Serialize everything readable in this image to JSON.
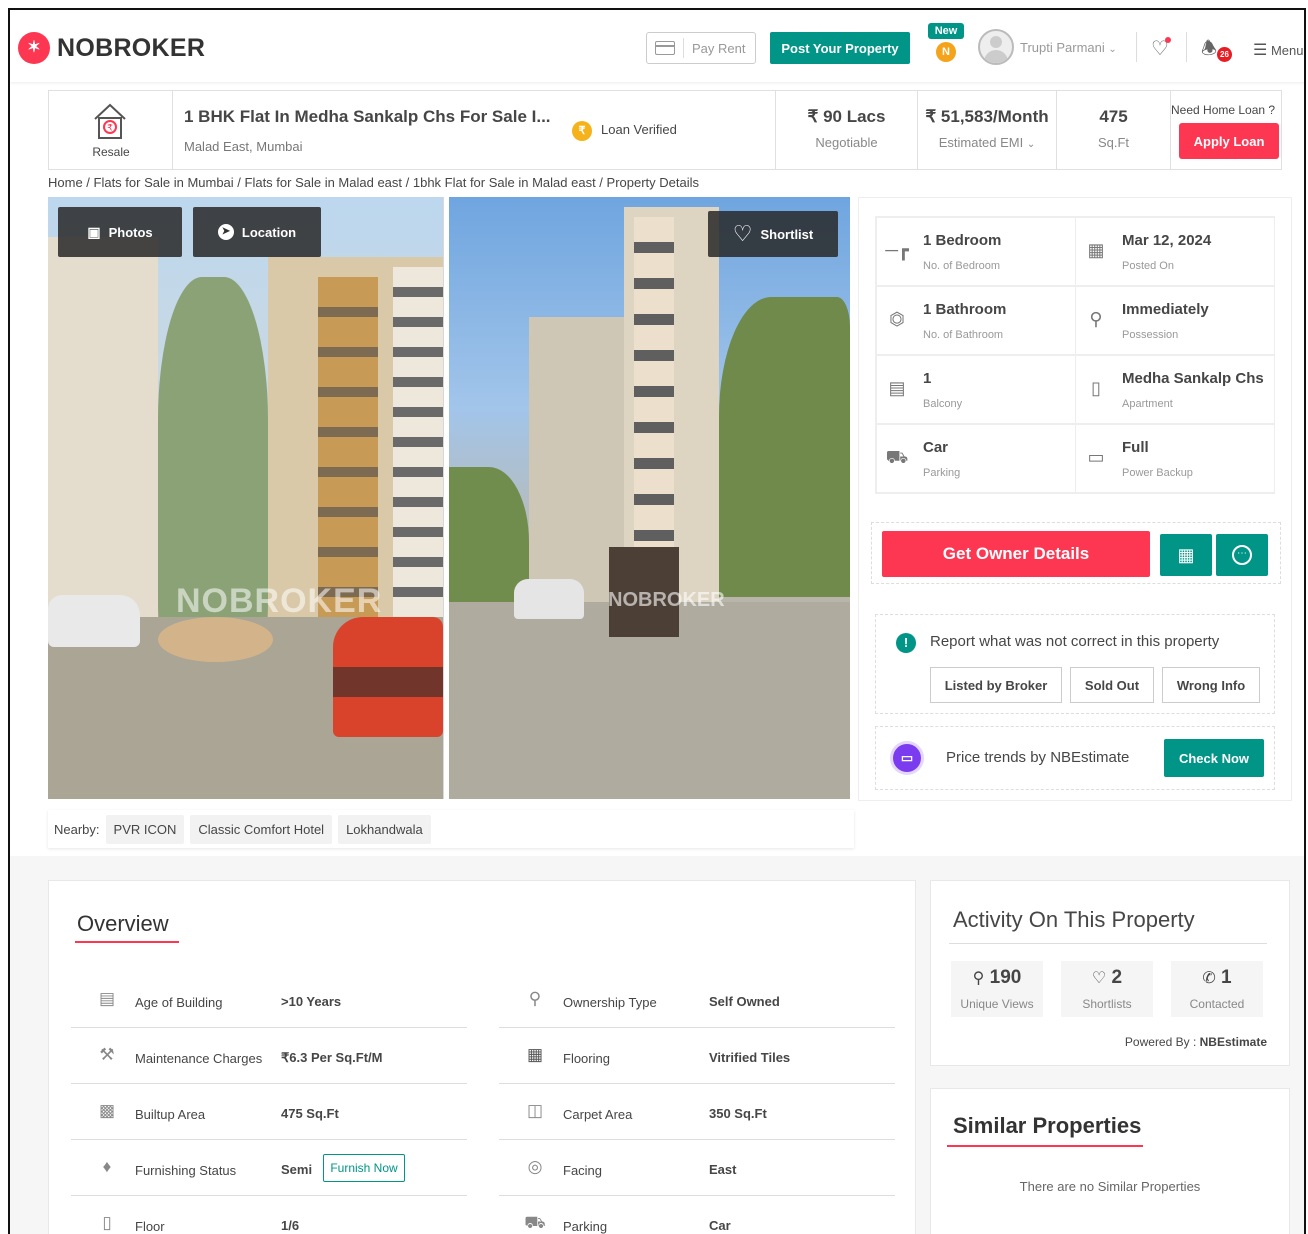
{
  "header": {
    "logo_mark": "✶",
    "logo_text": "NOBROKER",
    "pay_rent": "Pay Rent",
    "post_property": "Post Your Property",
    "new_tag": "New",
    "coin_letter": "N",
    "user_name": "Trupti Parmani",
    "notif_count": "26",
    "menu_label": "Menu"
  },
  "property": {
    "type_label": "Resale",
    "title": "1 BHK Flat In Medha Sankalp Chs For Sale I...",
    "location": "Malad East, Mumbai",
    "loan_verified": "Loan Verified",
    "price": "₹ 90 Lacs",
    "price_sub": "Negotiable",
    "emi": "₹ 51,583/Month",
    "emi_sub": "Estimated EMI",
    "area": "475",
    "area_sub": "Sq.Ft",
    "need_loan": "Need Home Loan ?",
    "apply_loan": "Apply Loan"
  },
  "breadcrumb": "Home / Flats for Sale in Mumbai / Flats for Sale in Malad east / 1bhk Flat for Sale in Malad east / Property Details",
  "gallery": {
    "photos_btn": "Photos",
    "location_btn": "Location",
    "shortlist_btn": "Shortlist",
    "watermark": "NOBROKER"
  },
  "nearby": {
    "label": "Nearby:",
    "items": [
      "PVR ICON",
      "Classic Comfort Hotel",
      "Lokhandwala"
    ]
  },
  "details": [
    {
      "value": "1 Bedroom",
      "label": "No. of Bedroom"
    },
    {
      "value": "Mar 12, 2024",
      "label": "Posted On"
    },
    {
      "value": "1 Bathroom",
      "label": "No. of Bathroom"
    },
    {
      "value": "Immediately",
      "label": "Possession"
    },
    {
      "value": "1",
      "label": "Balcony"
    },
    {
      "value": "Medha Sankalp Chs",
      "label": "Apartment"
    },
    {
      "value": "Car",
      "label": "Parking"
    },
    {
      "value": "Full",
      "label": "Power Backup"
    }
  ],
  "actions": {
    "owner_details": "Get Owner Details"
  },
  "report": {
    "title": "Report what was not correct in this property",
    "buttons": [
      "Listed by Broker",
      "Sold Out",
      "Wrong Info"
    ]
  },
  "trend": {
    "text": "Price trends by NBEstimate",
    "button": "Check Now"
  },
  "overview": {
    "title": "Overview",
    "rows": [
      {
        "label": "Age of Building",
        "value": ">10 Years"
      },
      {
        "label": "Ownership Type",
        "value": "Self Owned"
      },
      {
        "label": "Maintenance Charges",
        "value": "₹6.3 Per Sq.Ft/M"
      },
      {
        "label": "Flooring",
        "value": "Vitrified Tiles"
      },
      {
        "label": "Builtup Area",
        "value": "475 Sq.Ft"
      },
      {
        "label": "Carpet Area",
        "value": "350 Sq.Ft"
      },
      {
        "label": "Furnishing Status",
        "value": "Semi"
      },
      {
        "label": "Facing",
        "value": "East"
      },
      {
        "label": "Floor",
        "value": "1/6"
      },
      {
        "label": "Parking",
        "value": "Car"
      }
    ],
    "furnish_now": "Furnish Now"
  },
  "activity": {
    "title": "Activity On This Property",
    "stats": [
      {
        "value": "190",
        "label": "Unique Views"
      },
      {
        "value": "2",
        "label": "Shortlists"
      },
      {
        "value": "1",
        "label": "Contacted"
      }
    ],
    "powered_label": "Powered By :",
    "powered_value": "NBEstimate"
  },
  "similar": {
    "title": "Similar Properties",
    "empty": "There are no Similar Properties"
  },
  "colors": {
    "brand_red": "#fd3752",
    "brand_teal": "#009587"
  }
}
